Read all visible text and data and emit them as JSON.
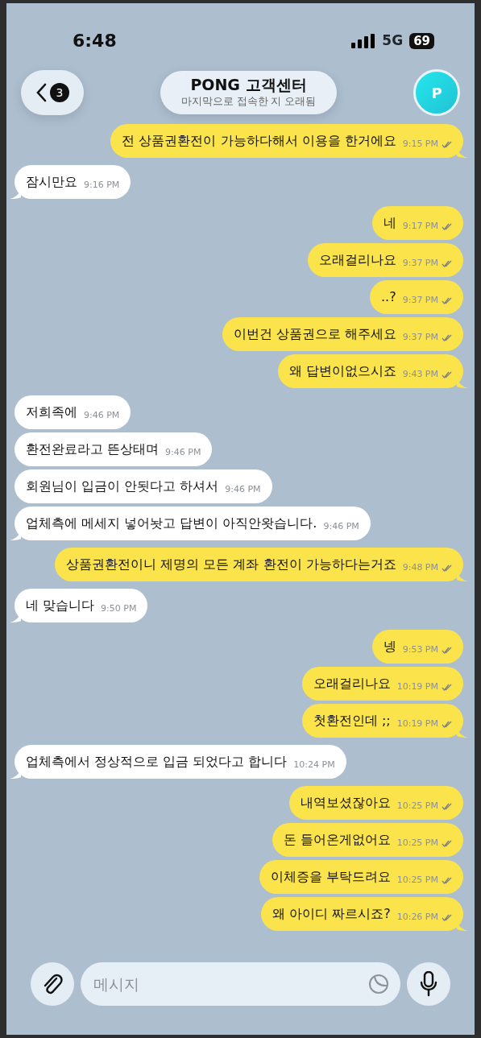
{
  "status_bar": {
    "time": "6:48",
    "network": "5G",
    "battery": "69"
  },
  "header": {
    "back_badge": "3",
    "title": "PONG 고객센터",
    "subtitle": "마지막으로 접속한 지 오래됨",
    "avatar_initial": "P"
  },
  "messages": [
    {
      "kind": "outgoing",
      "text": "전 상품권환전이 가능하다해서 이용을 한거에요",
      "time": "9:15 PM",
      "read": true
    },
    {
      "kind": "incoming",
      "text": "잠시만요",
      "time": "9:16 PM"
    },
    {
      "kind": "outgoing",
      "text": "네",
      "time": "9:17 PM",
      "read": true
    },
    {
      "kind": "outgoing",
      "text": "오래걸리나요",
      "time": "9:37 PM",
      "read": true
    },
    {
      "kind": "outgoing",
      "text": "..?",
      "time": "9:37 PM",
      "read": true
    },
    {
      "kind": "outgoing",
      "text": "이번건 상품권으로 해주세요",
      "time": "9:37 PM",
      "read": true
    },
    {
      "kind": "outgoing",
      "text": "왜 답변이없으시죠",
      "time": "9:43 PM",
      "read": true
    },
    {
      "kind": "incoming",
      "text": "저희족에",
      "time": "9:46 PM"
    },
    {
      "kind": "incoming",
      "text": "환전완료라고 뜬상태며",
      "time": "9:46 PM"
    },
    {
      "kind": "incoming",
      "text": "회원님이 입금이 안됫다고 하셔서",
      "time": "9:46 PM"
    },
    {
      "kind": "incoming",
      "text": "업체측에 메세지 넣어놧고 답변이 아직안왓습니다.",
      "time": "9:46 PM"
    },
    {
      "kind": "outgoing",
      "text": "상품권환전이니 제명의 모든 계좌 환전이 가능하다는거죠",
      "time": "9:48 PM",
      "read": true
    },
    {
      "kind": "incoming",
      "text": "네 맞습니다",
      "time": "9:50 PM"
    },
    {
      "kind": "outgoing",
      "text": "넹",
      "time": "9:53 PM",
      "read": true
    },
    {
      "kind": "outgoing",
      "text": "오래걸리나요",
      "time": "10:19 PM",
      "read": true
    },
    {
      "kind": "outgoing",
      "text": "첫환전인데 ;;",
      "time": "10:19 PM",
      "read": true
    },
    {
      "kind": "incoming",
      "text": "업체측에서 정상적으로 입금 되었다고 합니다",
      "time": "10:24 PM"
    },
    {
      "kind": "outgoing",
      "text": "내역보셨잖아요",
      "time": "10:25 PM",
      "read": true
    },
    {
      "kind": "outgoing",
      "text": "돈 들어온게없어요",
      "time": "10:25 PM",
      "read": true
    },
    {
      "kind": "outgoing",
      "text": "이체증을 부탁드려요",
      "time": "10:25 PM",
      "read": true
    },
    {
      "kind": "outgoing",
      "text": "왜 아이디 짜르시죠?",
      "time": "10:26 PM",
      "read": true
    }
  ],
  "composer": {
    "placeholder": "메시지"
  }
}
